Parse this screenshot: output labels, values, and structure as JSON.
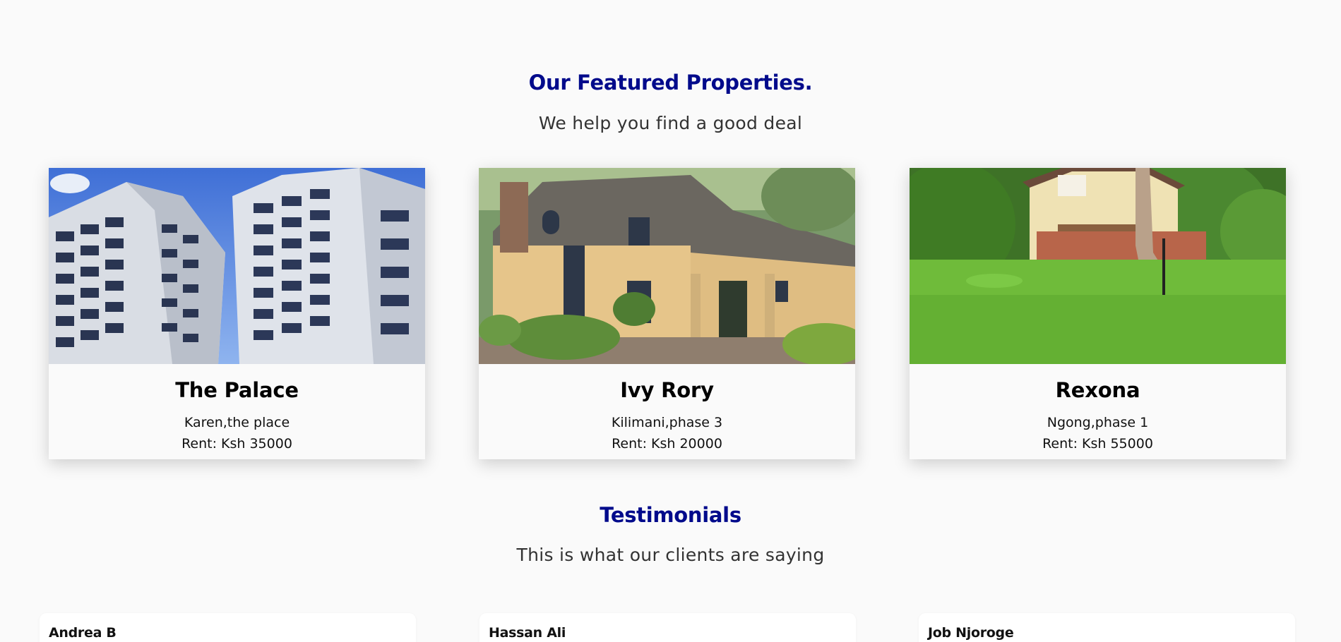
{
  "featured": {
    "title": "Our Featured Properties.",
    "subtitle": "We help you find a good deal"
  },
  "properties": [
    {
      "name": "The Palace",
      "location": "Karen,the place",
      "rent": "Rent: Ksh 35000",
      "image": "apartment-towers-photo"
    },
    {
      "name": "Ivy Rory",
      "location": "Kilimani,phase 3",
      "rent": "Rent: Ksh 20000",
      "image": "suburban-house-photo"
    },
    {
      "name": "Rexona",
      "location": "Ngong,phase 1",
      "rent": "Rent: Ksh 55000",
      "image": "house-with-lawn-photo"
    }
  ],
  "testimonials": {
    "title": "Testimonials",
    "subtitle": "This is what our clients are saying",
    "items": [
      {
        "name": "Andrea B"
      },
      {
        "name": "Hassan Ali"
      },
      {
        "name": "Job Njoroge"
      }
    ]
  },
  "colors": {
    "heading": "#000a8b",
    "background": "#fafafa"
  }
}
